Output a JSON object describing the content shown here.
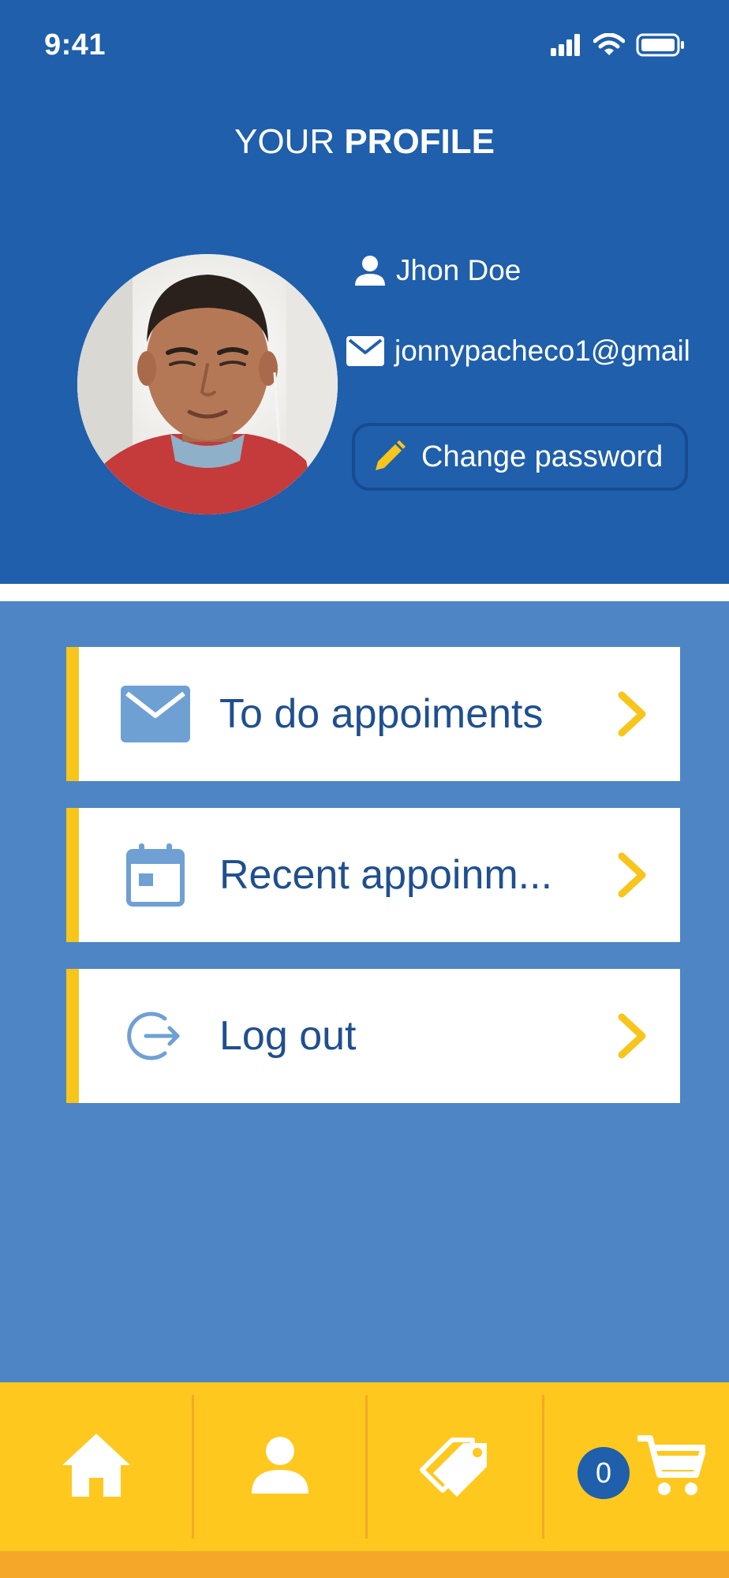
{
  "status_bar": {
    "time": "9:41"
  },
  "header": {
    "title_regular": "YOUR ",
    "title_bold": "PROFILE"
  },
  "profile": {
    "name": "Jhon Doe",
    "email": "jonnypacheco1@gmail",
    "change_password_label": "Change password"
  },
  "menu": {
    "items": [
      {
        "label": "To do appoiments",
        "icon": "mail-icon"
      },
      {
        "label": "Recent appoinm...",
        "icon": "calendar-icon"
      },
      {
        "label": "Log out",
        "icon": "logout-icon"
      }
    ]
  },
  "bottom_nav": {
    "items": [
      "home-icon",
      "user-icon",
      "tags-icon",
      "cart-icon"
    ],
    "cart_count": "0"
  },
  "colors": {
    "primary": "#1f5fac",
    "background": "#4e86c5",
    "accent": "#f8c51b",
    "text_dark": "#1f4f8f"
  }
}
